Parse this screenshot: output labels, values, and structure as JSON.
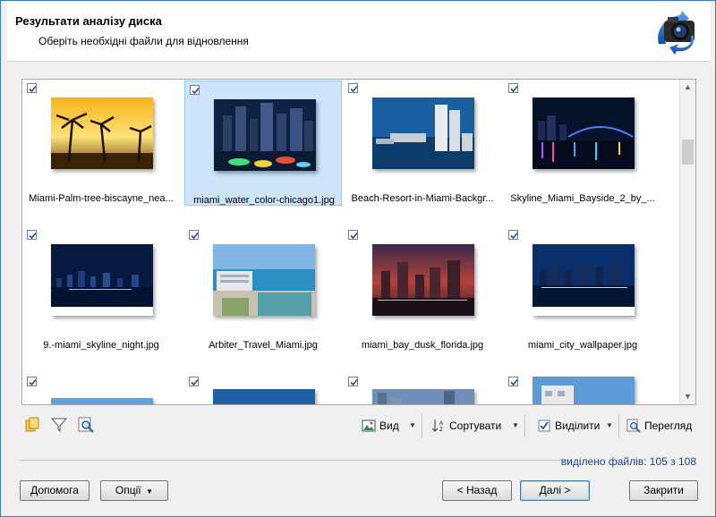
{
  "header": {
    "title": "Результати аналізу диска",
    "subtitle": "Оберіть необхідні файли для відновлення",
    "logo_icon": "camera-recovery-icon"
  },
  "gallery": {
    "items": [
      {
        "name": "Miami-Palm-tree-biscayne_nea...",
        "checked": true,
        "selected": false,
        "scene": "sunset"
      },
      {
        "name": "miami_water_color-chicago1.jpg",
        "checked": true,
        "selected": true,
        "scene": "night-color"
      },
      {
        "name": "Beach-Resort-in-Miami-Backgr...",
        "checked": true,
        "selected": false,
        "scene": "aerial"
      },
      {
        "name": "Skyline_Miami_Bayside_2_by_...",
        "checked": true,
        "selected": false,
        "scene": "night-bridge"
      },
      {
        "name": "9.-miami_skyline_night.jpg",
        "checked": true,
        "selected": false,
        "scene": "night-skyline"
      },
      {
        "name": "Arbiter_Travel_Miami.jpg",
        "checked": true,
        "selected": false,
        "scene": "resort"
      },
      {
        "name": "miami_bay_dusk_florida.jpg",
        "checked": true,
        "selected": false,
        "scene": "dusk"
      },
      {
        "name": "miami_city_wallpaper.jpg",
        "checked": true,
        "selected": false,
        "scene": "night-blue"
      },
      {
        "name": "",
        "checked": true,
        "selected": false,
        "scene": "sky"
      },
      {
        "name": "",
        "checked": true,
        "selected": false,
        "scene": "blue-top"
      },
      {
        "name": "",
        "checked": true,
        "selected": false,
        "scene": "city-day"
      },
      {
        "name": "",
        "checked": true,
        "selected": false,
        "scene": "building"
      }
    ]
  },
  "toolbar": {
    "left_icons": [
      "copy-files-icon",
      "filter-icon",
      "search-preview-icon"
    ],
    "view_label": "Вид",
    "sort_label": "Сортувати",
    "select_label": "Виділити",
    "preview_label": "Перегляд"
  },
  "status": {
    "selected_files": "виділено файлів: 105 з 108"
  },
  "buttons": {
    "help": "Допомога",
    "options": "Опції",
    "back": "< Назад",
    "next": "Далі >",
    "close": "Закрити"
  },
  "colors": {
    "window_border": "#3b78c4",
    "selected_bg": "#cde4fa",
    "count_text": "#1e3f8a"
  }
}
